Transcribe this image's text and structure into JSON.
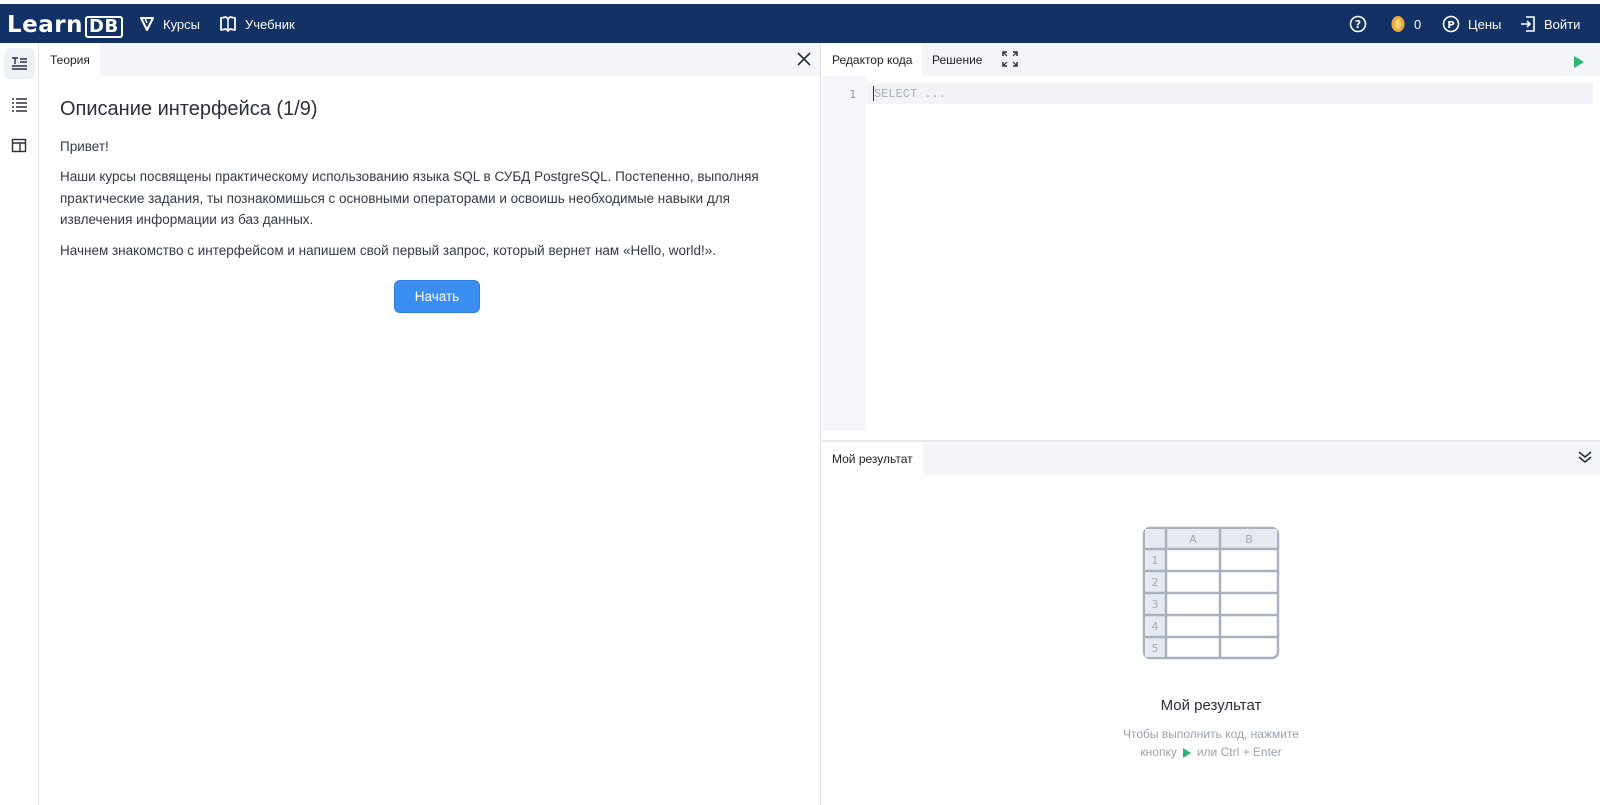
{
  "header": {
    "logo_learn": "Learn",
    "logo_db": "DB",
    "nav": {
      "courses": "Курсы",
      "tutorial": "Учебник"
    },
    "coins": "0",
    "prices": "Цены",
    "login": "Войти",
    "bg_color": "#123266"
  },
  "theory": {
    "tab": "Теория",
    "title": "Описание интерфейса (1/9)",
    "greeting": "Привет!",
    "p1": "Наши курсы посвящены практическому использованию языка SQL в СУБД PostgreSQL. Постепенно, выполняя практические задания, ты познакомишься с основными операторами и освоишь необходимые навыки для извлечения информации из баз данных.",
    "p2": "Начнем знакомство с интерфейсом и напишем свой первый запрос, который вернет нам «Hello, world!».",
    "start_button": "Начать"
  },
  "editor": {
    "tabs": [
      "Редактор кода",
      "Решение"
    ],
    "line_number": "1",
    "placeholder": "SELECT ..."
  },
  "result": {
    "tab": "Мой результат",
    "illustration": {
      "cols": [
        "A",
        "B"
      ],
      "rows": [
        "1",
        "2",
        "3",
        "4",
        "5"
      ]
    },
    "title": "Мой результат",
    "hint_line1": "Чтобы выполнить код, нажмите",
    "hint_line2_pre": "кнопку",
    "hint_line2_post": "или Ctrl + Enter"
  },
  "colors": {
    "accent": "#3b8ef0",
    "run": "#2bb673"
  }
}
